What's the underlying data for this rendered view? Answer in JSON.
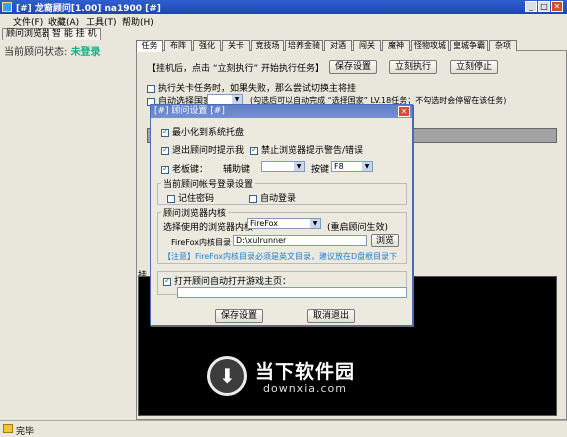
{
  "window": {
    "title": "[#] 龙裔顾问[1.00] na1900 [#]",
    "colors": {
      "titlebar": "#1f45b5",
      "status_ok": "#18b08a",
      "notice": "#1f7fd0"
    }
  },
  "menu": [
    "文件(F)",
    "收藏(A)",
    "工具(T)",
    "帮助(H)"
  ],
  "left_tabs": [
    "顾问浏览器",
    "智 能 挂 机"
  ],
  "status": {
    "label": "当前顾问状态:",
    "value": "未登录"
  },
  "tabs": [
    "任务",
    "布阵",
    "强化",
    "关卡",
    "竞技场",
    "培养金骑",
    "对酒",
    "闯关",
    "魔神",
    "怪物攻城",
    "皇城争霸",
    "杂项"
  ],
  "task_panel": {
    "hint": "【挂机后，点击 “立刻执行” 开始执行任务】",
    "save_btn": "保存设置",
    "run_btn": "立刻执行",
    "stop_btn": "立刻停止",
    "opt1": "执行关卡任务时，如果失败，那么尝试切换主将挂",
    "opt2": "自动选择国家",
    "opt2_note": "(勾选后可以自动完成 “选择国家” LV.18任务；不勾选时会停留在该任务)",
    "log_label": "挂"
  },
  "dialog": {
    "title": "[#] 顾问设置 [#]",
    "close": "✕",
    "opt_minimize": "最小化到系统托盘",
    "opt_exit_prompt": "退出顾问时提示我",
    "opt_block_alerts": "禁止浏览器提示警告/错误",
    "boss_key_label": "老板键：",
    "modifier_label": "辅助键",
    "key_label": "按键",
    "key_value": "F8",
    "account_group": "当前顾问帐号登录设置",
    "remember_pwd": "记住密码",
    "auto_login": "自动登录",
    "browser_group": "顾问浏览器内核",
    "engine_label": "选择使用的浏览器内核",
    "engine_value": "FireFox",
    "engine_note": "(重启顾问生效)",
    "ff_dir_label": "FireFox内核目录",
    "ff_dir_value": "D:\\xulrunner",
    "browse_btn": "浏览",
    "notice": "【注意】FireFox内核目录必须是英文目录，建议放在D盘根目录下",
    "open_homepage": "打开顾问自动打开游戏主页：",
    "homepage_value": "",
    "save_btn": "保存设置",
    "cancel_btn": "取消退出"
  },
  "watermark": {
    "line1": "当下软件园",
    "line2": "downxia.com"
  },
  "statusbar": {
    "text": "完毕"
  }
}
